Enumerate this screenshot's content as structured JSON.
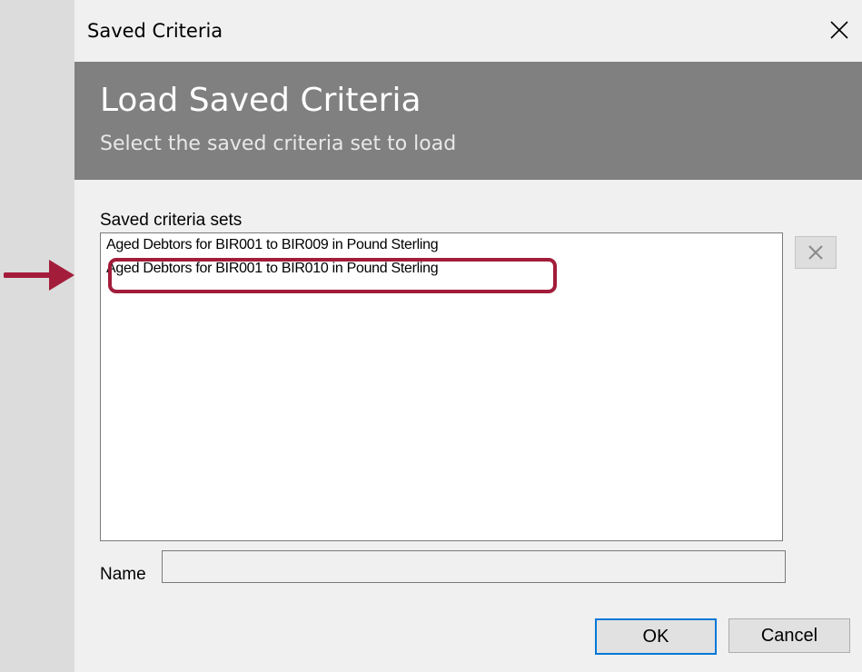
{
  "window": {
    "title": "Saved Criteria",
    "close_icon": "close-icon"
  },
  "header": {
    "title": "Load Saved Criteria",
    "subtitle": "Select the saved criteria set to load"
  },
  "list": {
    "label": "Saved criteria sets",
    "items": [
      "Aged Debtors for BIR001 to BIR009 in Pound Sterling",
      "Aged Debtors for BIR001 to BIR010 in Pound Sterling"
    ],
    "delete_icon": "delete-icon"
  },
  "name_field": {
    "label": "Name",
    "value": ""
  },
  "buttons": {
    "ok": "OK",
    "cancel": "Cancel"
  },
  "colors": {
    "header_bg": "#808080",
    "annotation": "#a31d3b",
    "focus": "#0078d7"
  }
}
